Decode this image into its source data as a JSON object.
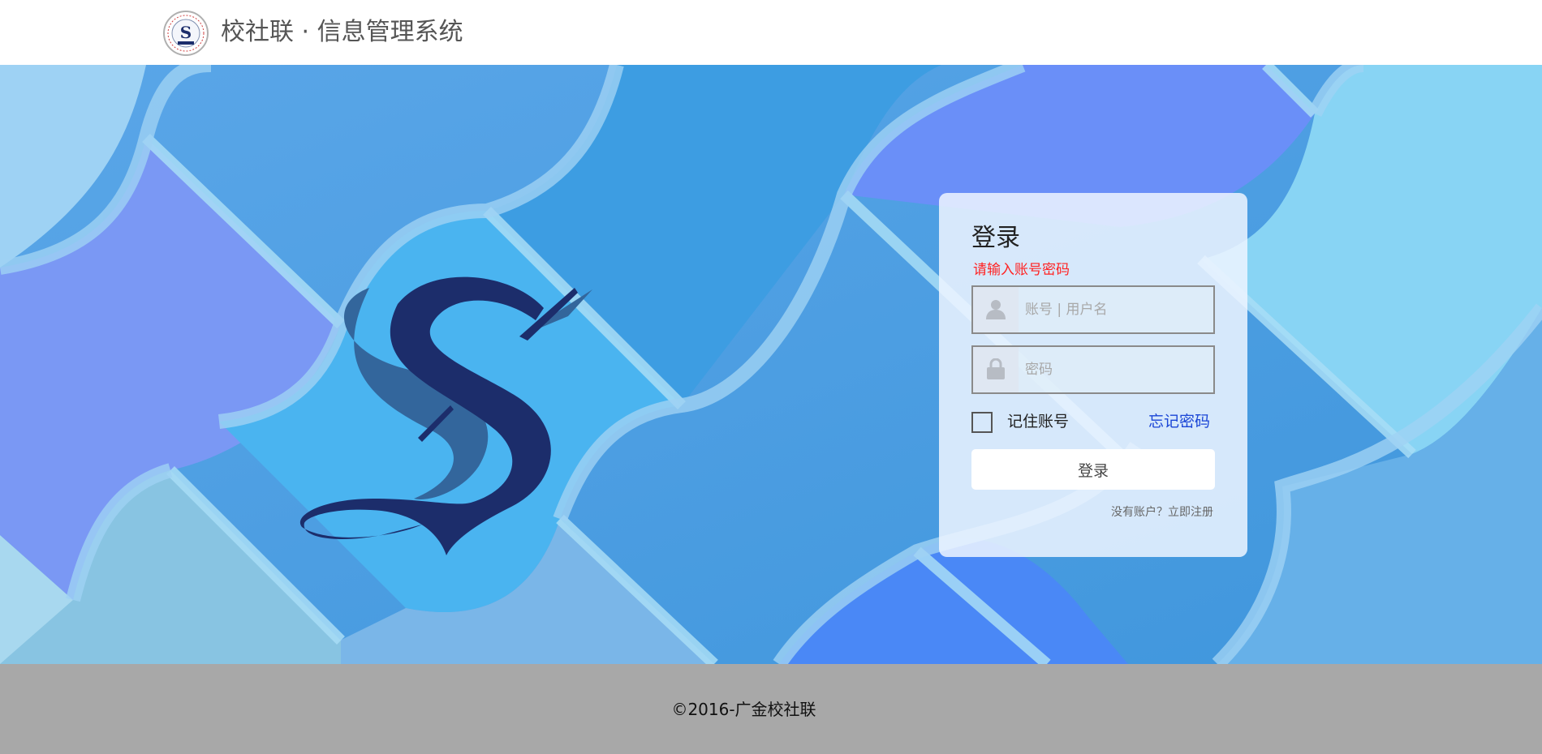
{
  "header": {
    "site_title": "校社联 · 信息管理系统",
    "logo_icon": "seal-s-logo"
  },
  "login": {
    "title": "登录",
    "error_message": "请输入账号密码",
    "username_placeholder": "账号 | 用户名",
    "password_placeholder": "密码",
    "username_icon": "user-icon",
    "password_icon": "lock-icon",
    "remember_label": "记住账号",
    "remember_checked": false,
    "forgot_link": "忘记密码",
    "submit_label": "登录",
    "register_prompt": "没有账户？立即注册"
  },
  "footer": {
    "copyright": "©2016-广金校社联"
  },
  "colors": {
    "error": "#ff2222",
    "link": "#1a45d6",
    "footer_bg": "#a8a8a8",
    "brand_navy": "#1c2d6b",
    "brand_steel": "#33669c"
  }
}
